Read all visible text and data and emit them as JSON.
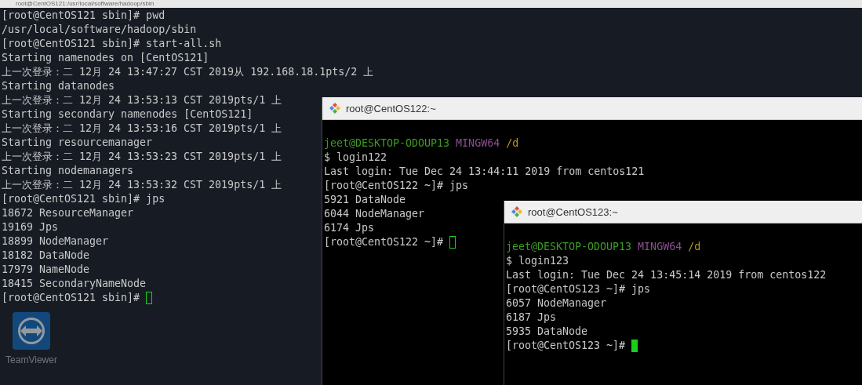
{
  "desktop": {
    "icons": [
      {
        "label": "TeamViewer"
      }
    ]
  },
  "windows": [
    {
      "title": "root@CentOS121:/usr/local/software/hadoop/sbin",
      "focused": false,
      "lines": [
        {
          "kind": "text",
          "text": "[root@CentOS121 sbin]# pwd"
        },
        {
          "kind": "text",
          "text": "/usr/local/software/hadoop/sbin"
        },
        {
          "kind": "text",
          "text": "[root@CentOS121 sbin]# start-all.sh"
        },
        {
          "kind": "text",
          "text": "Starting namenodes on [CentOS121]"
        },
        {
          "kind": "text",
          "text": "上一次登录：二 12月 24 13:47:27 CST 2019从 192.168.18.1pts/2 上"
        },
        {
          "kind": "text",
          "text": "Starting datanodes"
        },
        {
          "kind": "text",
          "text": "上一次登录：二 12月 24 13:53:13 CST 2019pts/1 上"
        },
        {
          "kind": "text",
          "text": "Starting secondary namenodes [CentOS121]"
        },
        {
          "kind": "text",
          "text": "上一次登录：二 12月 24 13:53:16 CST 2019pts/1 上"
        },
        {
          "kind": "text",
          "text": "Starting resourcemanager"
        },
        {
          "kind": "text",
          "text": "上一次登录：二 12月 24 13:53:23 CST 2019pts/1 上"
        },
        {
          "kind": "text",
          "text": "Starting nodemanagers"
        },
        {
          "kind": "text",
          "text": "上一次登录：二 12月 24 13:53:32 CST 2019pts/1 上"
        },
        {
          "kind": "text",
          "text": "[root@CentOS121 sbin]# jps"
        },
        {
          "kind": "text",
          "text": "18672 ResourceManager"
        },
        {
          "kind": "text",
          "text": "19169 Jps"
        },
        {
          "kind": "text",
          "text": "18899 NodeManager"
        },
        {
          "kind": "text",
          "text": "18182 DataNode"
        },
        {
          "kind": "text",
          "text": "17979 NameNode"
        },
        {
          "kind": "text",
          "text": "18415 SecondaryNameNode"
        },
        {
          "kind": "prompt",
          "text": "[root@CentOS121 sbin]#"
        }
      ]
    },
    {
      "title": "root@CentOS122:~",
      "focused": false,
      "lines": [
        {
          "kind": "mingw",
          "user": "jeet@DESKTOP-ODOUP13",
          "env": "MINGW64",
          "path": "/d"
        },
        {
          "kind": "text",
          "text": "$ login122"
        },
        {
          "kind": "text",
          "text": "Last login: Tue Dec 24 13:44:11 2019 from centos121"
        },
        {
          "kind": "text",
          "text": "[root@CentOS122 ~]# jps"
        },
        {
          "kind": "text",
          "text": "5921 DataNode"
        },
        {
          "kind": "text",
          "text": "6044 NodeManager"
        },
        {
          "kind": "text",
          "text": "6174 Jps"
        },
        {
          "kind": "prompt",
          "text": "[root@CentOS122 ~]#"
        }
      ]
    },
    {
      "title": "root@CentOS123:~",
      "focused": true,
      "lines": [
        {
          "kind": "mingw",
          "user": "jeet@DESKTOP-ODOUP13",
          "env": "MINGW64",
          "path": "/d"
        },
        {
          "kind": "text",
          "text": "$ login123"
        },
        {
          "kind": "text",
          "text": "Last login: Tue Dec 24 13:45:14 2019 from centos122"
        },
        {
          "kind": "text",
          "text": "[root@CentOS123 ~]# jps"
        },
        {
          "kind": "text",
          "text": "6057 NodeManager"
        },
        {
          "kind": "text",
          "text": "6187 Jps"
        },
        {
          "kind": "text",
          "text": "5935 DataNode"
        },
        {
          "kind": "prompt",
          "text": "[root@CentOS123 ~]#"
        }
      ]
    }
  ]
}
